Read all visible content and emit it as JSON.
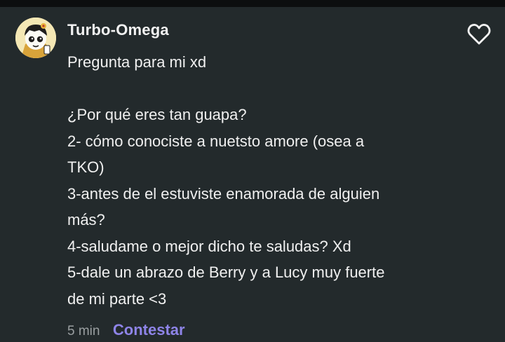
{
  "comment": {
    "author": "Turbo-Omega",
    "lines": [
      "Pregunta para mi xd",
      "",
      "¿Por qué eres tan guapa?",
      "2- cómo conociste a nuetsto amore (osea a",
      "TKO)",
      "3-antes de el estuviste enamorada de alguien",
      "más?",
      "4-saludame o mejor dicho te saludas? Xd",
      "5-dale un abrazo de Berry y a Lucy muy fuerte",
      "de mi parte <3"
    ],
    "time": "5 min",
    "reply_label": "Contestar",
    "like_icon": "heart-outline-icon"
  },
  "colors": {
    "background": "#232a2c",
    "text": "#f0f0f0",
    "muted": "#9a9fa1",
    "accent": "#8e84e8"
  }
}
